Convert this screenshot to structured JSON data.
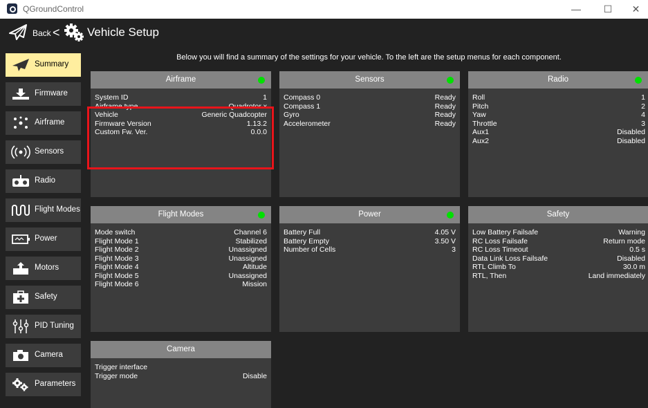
{
  "window": {
    "title": "QGroundControl",
    "minimize_glyph": "—",
    "maximize_glyph": "☐",
    "close_glyph": "✕"
  },
  "header": {
    "back_label": "Back",
    "separator": "<",
    "title": "Vehicle Setup",
    "icons": [
      "paper-plane-icon",
      "gears-icon"
    ]
  },
  "summary_text": "Below you will find a summary of the settings for your vehicle. To the left are the setup menus for each component.",
  "sidebar": {
    "items": [
      {
        "label": "Summary",
        "icon": "paper-plane-icon",
        "active": true
      },
      {
        "label": "Firmware",
        "icon": "download-icon",
        "active": false
      },
      {
        "label": "Airframe",
        "icon": "airframe-icon",
        "active": false
      },
      {
        "label": "Sensors",
        "icon": "radio-waves-icon",
        "active": false
      },
      {
        "label": "Radio",
        "icon": "radio-transmitter-icon",
        "active": false
      },
      {
        "label": "Flight Modes",
        "icon": "flight-modes-icon",
        "active": false
      },
      {
        "label": "Power",
        "icon": "battery-icon",
        "active": false
      },
      {
        "label": "Motors",
        "icon": "motor-icon",
        "active": false
      },
      {
        "label": "Safety",
        "icon": "first-aid-icon",
        "active": false
      },
      {
        "label": "PID Tuning",
        "icon": "sliders-icon",
        "active": false
      },
      {
        "label": "Camera",
        "icon": "camera-icon",
        "active": false
      },
      {
        "label": "Parameters",
        "icon": "gears-icon",
        "active": false
      }
    ]
  },
  "colors": {
    "background": "#222222",
    "card": "#3c3c3c",
    "card_header": "#848484",
    "active_item": "#ffee9f",
    "status_ok": "#00e000",
    "highlight": "#e8141a"
  },
  "cards": {
    "airframe": {
      "title": "Airframe",
      "status": "ok",
      "rows": [
        {
          "label": "System ID",
          "value": "1"
        },
        {
          "label": "Airframe type",
          "value": "Quadrotor x"
        },
        {
          "label": "Vehicle",
          "value": "Generic Quadcopter"
        },
        {
          "label": "Firmware Version",
          "value": "1.13.2"
        },
        {
          "label": "Custom Fw. Ver.",
          "value": "0.0.0"
        }
      ]
    },
    "sensors": {
      "title": "Sensors",
      "status": "ok",
      "rows": [
        {
          "label": "Compass 0",
          "value": "Ready"
        },
        {
          "label": "Compass 1",
          "value": "Ready"
        },
        {
          "label": "Gyro",
          "value": "Ready"
        },
        {
          "label": "Accelerometer",
          "value": "Ready"
        }
      ]
    },
    "radio": {
      "title": "Radio",
      "status": "ok",
      "rows": [
        {
          "label": "Roll",
          "value": "1"
        },
        {
          "label": "Pitch",
          "value": "2"
        },
        {
          "label": "Yaw",
          "value": "4"
        },
        {
          "label": "Throttle",
          "value": "3"
        },
        {
          "label": "Aux1",
          "value": "Disabled"
        },
        {
          "label": "Aux2",
          "value": "Disabled"
        }
      ]
    },
    "flight_modes": {
      "title": "Flight Modes",
      "status": "ok",
      "rows": [
        {
          "label": "Mode switch",
          "value": "Channel 6"
        },
        {
          "label": "Flight Mode 1",
          "value": "Stabilized"
        },
        {
          "label": "Flight Mode 2",
          "value": "Unassigned"
        },
        {
          "label": "Flight Mode 3",
          "value": "Unassigned"
        },
        {
          "label": "Flight Mode 4",
          "value": "Altitude"
        },
        {
          "label": "Flight Mode 5",
          "value": "Unassigned"
        },
        {
          "label": "Flight Mode 6",
          "value": "Mission"
        }
      ]
    },
    "power": {
      "title": "Power",
      "status": "ok",
      "rows": [
        {
          "label": "Battery Full",
          "value": "4.05 V"
        },
        {
          "label": "Battery Empty",
          "value": "3.50 V"
        },
        {
          "label": "Number of Cells",
          "value": "3"
        }
      ]
    },
    "safety": {
      "title": "Safety",
      "status": "none",
      "rows": [
        {
          "label": "Low Battery Failsafe",
          "value": "Warning"
        },
        {
          "label": "RC Loss Failsafe",
          "value": "Return mode"
        },
        {
          "label": "RC Loss Timeout",
          "value": "0.5 s"
        },
        {
          "label": "Data Link Loss Failsafe",
          "value": "Disabled"
        },
        {
          "label": "RTL Climb To",
          "value": "30.0 m"
        },
        {
          "label": "RTL, Then",
          "value": "Land immediately"
        }
      ]
    },
    "camera": {
      "title": "Camera",
      "status": "none",
      "rows": [
        {
          "label": "Trigger interface",
          "value": ""
        },
        {
          "label": "Trigger mode",
          "value": "Disable"
        }
      ]
    }
  }
}
